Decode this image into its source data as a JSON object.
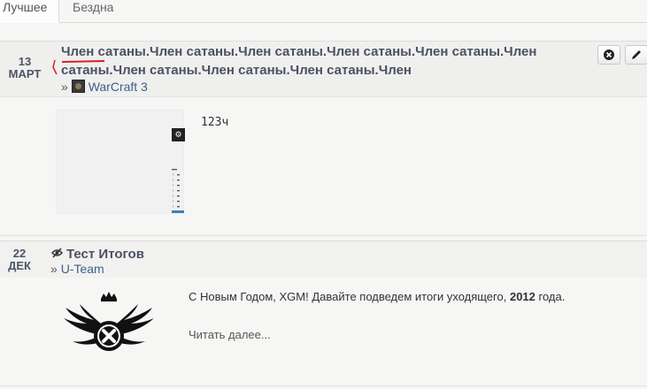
{
  "tabs": [
    {
      "label": "Лучшее"
    },
    {
      "label": "Бездна"
    }
  ],
  "post1": {
    "date_day": "13",
    "date_month": "МАРТ",
    "title_line1": "Член сатаны.Член сатаны.Член сатаны.Член сатаны.Член сатаны.Член",
    "title_line2": "сатаны.Член сатаны.Член сатаны.Член сатаны.Член",
    "forum_arrow": "»",
    "forum_name": "WarCraft 3",
    "forum_icon": "warcraft-icon",
    "body": "123ч",
    "tools": [
      {
        "icon": "settings-icon"
      },
      {
        "icon": "edit-icon"
      }
    ]
  },
  "post2": {
    "date_day": "22",
    "date_month": "ДЕК",
    "title": "Тест Итогов",
    "title_icon": "eye-icon",
    "forum_arrow": "»",
    "forum_name": "U-Team",
    "body_before": "С Новым Годом, XGM! Давайте подведем итоги уходящего,",
    "body_bold": "2012",
    "body_after": "года.",
    "read_more": "Читать далее..."
  },
  "colors": {
    "title": "#4b5262",
    "link": "#3f5f8a",
    "date": "#4a5566",
    "accent_red": "#d62020"
  }
}
